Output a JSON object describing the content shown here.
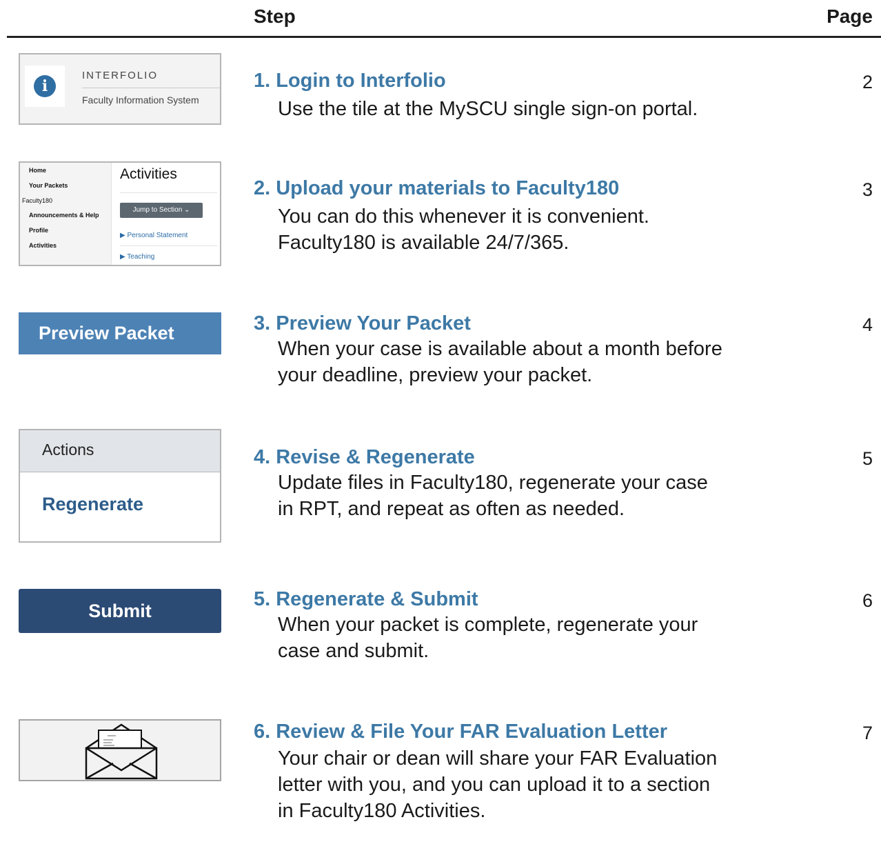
{
  "header": {
    "step": "Step",
    "page": "Page"
  },
  "steps": [
    {
      "title": "1. Login to Interfolio",
      "lines": [
        "Use the tile at the MySCU single sign-on portal."
      ],
      "page": "2"
    },
    {
      "title": "2. Upload your materials to Faculty180",
      "lines": [
        "You can do this whenever it is convenient.",
        "Faculty180 is available 24/7/365."
      ],
      "page": "3"
    },
    {
      "title": "3. Preview Your Packet",
      "lines": [
        "When your case is available about a month before",
        "your deadline, preview your packet."
      ],
      "page": "4"
    },
    {
      "title": "4. Revise & Regenerate",
      "lines": [
        "Update files in Faculty180, regenerate your case",
        "in RPT, and repeat as often as needed."
      ],
      "page": "5"
    },
    {
      "title": "5. Regenerate & Submit",
      "lines": [
        "When your packet is complete, regenerate your",
        "case and submit."
      ],
      "page": "6"
    },
    {
      "title": "6. Review & File Your FAR Evaluation Letter",
      "lines": [
        "Your chair or dean will share your FAR Evaluation",
        "letter with you, and you can upload it to a section",
        "in Faculty180 Activities."
      ],
      "page": "7"
    }
  ],
  "thumb1": {
    "icon": "i",
    "brand": "INTERFOLIO",
    "subtitle": "Faculty Information System"
  },
  "thumb2": {
    "nav": [
      "Home",
      "Your Packets",
      "Faculty180",
      "Announcements & Help",
      "Profile",
      "Activities"
    ],
    "heading": "Activities",
    "jump_label": "Jump to Section ⌄",
    "rows": [
      "▶  Personal Statement",
      "▶  Teaching"
    ]
  },
  "thumb3": {
    "label": "Preview Packet"
  },
  "thumb4": {
    "header": "Actions",
    "action": "Regenerate"
  },
  "thumb5": {
    "label": "Submit"
  },
  "colors": {
    "step_title": "#3d79a6",
    "preview_button": "#4d82b5",
    "submit_button": "#2b4a74",
    "regenerate_link": "#2d5c8a",
    "info_icon": "#2f6ea3"
  }
}
